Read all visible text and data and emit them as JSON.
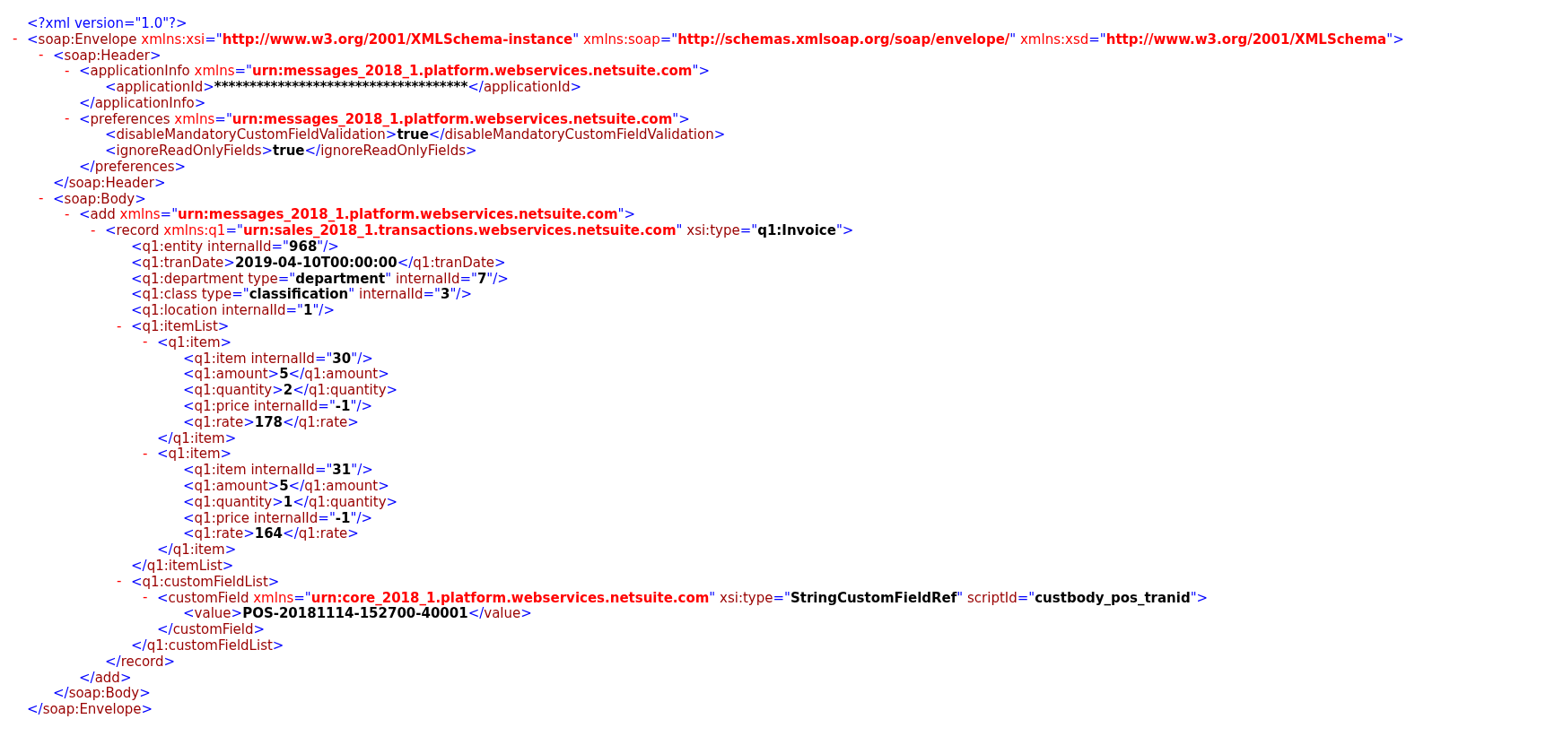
{
  "markup": {
    "open": "<",
    "close": ">",
    "end_open": "</",
    "self_close": "/>",
    "equals": "=",
    "quote": "\""
  },
  "declaration": "<?xml version=\"1.0\"?>",
  "document": {
    "tag": "soap:Envelope",
    "close_tag": "soap:Envelope",
    "toggle": "-",
    "expanded": true,
    "attributes": [
      {
        "name": "xmlns:xsi",
        "value": "http://www.w3.org/2001/XMLSchema-instance",
        "kind": "xmlns"
      },
      {
        "name": "xmlns:soap",
        "value": "http://schemas.xmlsoap.org/soap/envelope/",
        "kind": "xmlns"
      },
      {
        "name": "xmlns:xsd",
        "value": "http://www.w3.org/2001/XMLSchema",
        "kind": "xmlns"
      }
    ],
    "children": [
      {
        "tag": "soap:Header",
        "close_tag": "soap:Header",
        "toggle": "-",
        "expanded": true,
        "children": [
          {
            "tag": "applicationInfo",
            "close_tag": "applicationInfo",
            "toggle": "-",
            "expanded": true,
            "attributes": [
              {
                "name": "xmlns",
                "value": "urn:messages_2018_1.platform.webservices.netsuite.com",
                "kind": "xmlns"
              }
            ],
            "children": [
              {
                "tag": "applicationId",
                "close_tag": "applicationId",
                "text": "************************************"
              }
            ]
          },
          {
            "tag": "preferences",
            "close_tag": "preferences",
            "toggle": "-",
            "expanded": true,
            "attributes": [
              {
                "name": "xmlns",
                "value": "urn:messages_2018_1.platform.webservices.netsuite.com",
                "kind": "xmlns"
              }
            ],
            "children": [
              {
                "tag": "disableMandatoryCustomFieldValidation",
                "close_tag": "disableMandatoryCustomFieldValidation",
                "text": "true"
              },
              {
                "tag": "ignoreReadOnlyFields",
                "close_tag": "ignoreReadOnlyFields",
                "text": "true"
              }
            ]
          }
        ]
      },
      {
        "tag": "soap:Body",
        "close_tag": "soap:Body",
        "toggle": "-",
        "expanded": true,
        "children": [
          {
            "tag": "add",
            "close_tag": "add",
            "toggle": "-",
            "expanded": true,
            "attributes": [
              {
                "name": "xmlns",
                "value": "urn:messages_2018_1.platform.webservices.netsuite.com",
                "kind": "xmlns"
              }
            ],
            "children": [
              {
                "tag": "record",
                "close_tag": "record",
                "toggle": "-",
                "expanded": true,
                "attributes": [
                  {
                    "name": "xmlns:q1",
                    "value": "urn:sales_2018_1.transactions.webservices.netsuite.com",
                    "kind": "xmlns"
                  },
                  {
                    "name": "xsi:type",
                    "value": "q1:Invoice",
                    "kind": "attr"
                  }
                ],
                "children": [
                  {
                    "tag": "q1:entity",
                    "attributes": [
                      {
                        "name": "internalId",
                        "value": "968",
                        "kind": "attr"
                      }
                    ]
                  },
                  {
                    "tag": "q1:tranDate",
                    "close_tag": "q1:tranDate",
                    "text": "2019-04-10T00:00:00"
                  },
                  {
                    "tag": "q1:department",
                    "attributes": [
                      {
                        "name": "type",
                        "value": "department",
                        "kind": "attr"
                      },
                      {
                        "name": "internalId",
                        "value": "7",
                        "kind": "attr"
                      }
                    ]
                  },
                  {
                    "tag": "q1:class",
                    "attributes": [
                      {
                        "name": "type",
                        "value": "classification",
                        "kind": "attr"
                      },
                      {
                        "name": "internalId",
                        "value": "3",
                        "kind": "attr"
                      }
                    ]
                  },
                  {
                    "tag": "q1:location",
                    "attributes": [
                      {
                        "name": "internalId",
                        "value": "1",
                        "kind": "attr"
                      }
                    ]
                  },
                  {
                    "tag": "q1:itemList",
                    "close_tag": "q1:itemList",
                    "toggle": "-",
                    "expanded": true,
                    "children": [
                      {
                        "tag": "q1:item",
                        "close_tag": "q1:item",
                        "toggle": "-",
                        "expanded": true,
                        "children": [
                          {
                            "tag": "q1:item",
                            "attributes": [
                              {
                                "name": "internalId",
                                "value": "30",
                                "kind": "attr"
                              }
                            ]
                          },
                          {
                            "tag": "q1:amount",
                            "close_tag": "q1:amount",
                            "text": "5"
                          },
                          {
                            "tag": "q1:quantity",
                            "close_tag": "q1:quantity",
                            "text": "2"
                          },
                          {
                            "tag": "q1:price",
                            "attributes": [
                              {
                                "name": "internalId",
                                "value": "-1",
                                "kind": "attr"
                              }
                            ]
                          },
                          {
                            "tag": "q1:rate",
                            "close_tag": "q1:rate",
                            "text": "178"
                          }
                        ]
                      },
                      {
                        "tag": "q1:item",
                        "close_tag": "q1:item",
                        "toggle": "-",
                        "expanded": true,
                        "children": [
                          {
                            "tag": "q1:item",
                            "attributes": [
                              {
                                "name": "internalId",
                                "value": "31",
                                "kind": "attr"
                              }
                            ]
                          },
                          {
                            "tag": "q1:amount",
                            "close_tag": "q1:amount",
                            "text": "5"
                          },
                          {
                            "tag": "q1:quantity",
                            "close_tag": "q1:quantity",
                            "text": "1"
                          },
                          {
                            "tag": "q1:price",
                            "attributes": [
                              {
                                "name": "internalId",
                                "value": "-1",
                                "kind": "attr"
                              }
                            ]
                          },
                          {
                            "tag": "q1:rate",
                            "close_tag": "q1:rate",
                            "text": "164"
                          }
                        ]
                      }
                    ]
                  },
                  {
                    "tag": "q1:customFieldList",
                    "close_tag": "q1:customFieldList",
                    "toggle": "-",
                    "expanded": true,
                    "children": [
                      {
                        "tag": "customField",
                        "close_tag": "customField",
                        "toggle": "-",
                        "expanded": true,
                        "attributes": [
                          {
                            "name": "xmlns",
                            "value": "urn:core_2018_1.platform.webservices.netsuite.com",
                            "kind": "xmlns"
                          },
                          {
                            "name": "xsi:type",
                            "value": "StringCustomFieldRef",
                            "kind": "attr"
                          },
                          {
                            "name": "scriptId",
                            "value": "custbody_pos_tranid",
                            "kind": "attr"
                          }
                        ],
                        "children": [
                          {
                            "tag": "value",
                            "close_tag": "value",
                            "text": "POS-20181114-152700-40001"
                          }
                        ]
                      }
                    ]
                  }
                ]
              }
            ]
          }
        ]
      }
    ]
  }
}
